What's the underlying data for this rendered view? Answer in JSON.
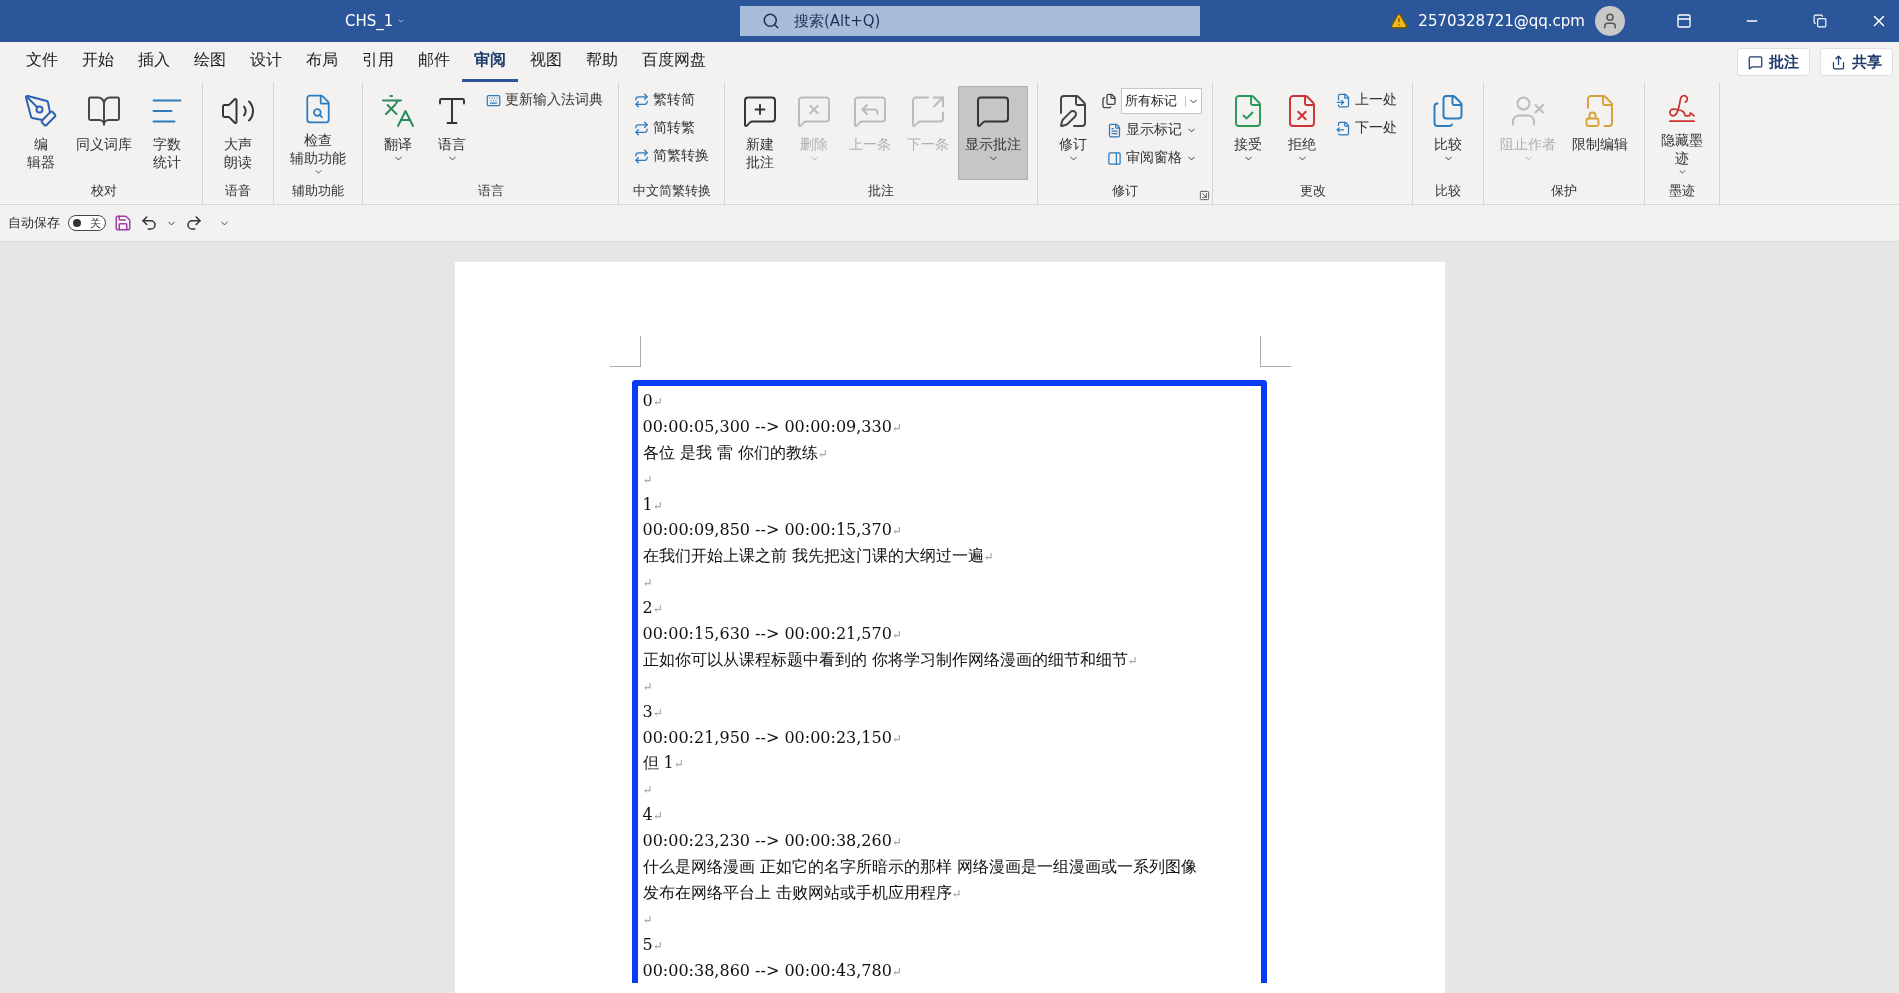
{
  "title_bar": {
    "document_title": "CHS_1",
    "search": {
      "placeholder": "搜索(Alt+Q)"
    },
    "account": "2570328721@qq.cpm"
  },
  "menu_tabs": [
    {
      "label": "文件",
      "selected": false
    },
    {
      "label": "开始",
      "selected": false
    },
    {
      "label": "插入",
      "selected": false
    },
    {
      "label": "绘图",
      "selected": false
    },
    {
      "label": "设计",
      "selected": false
    },
    {
      "label": "布局",
      "selected": false
    },
    {
      "label": "引用",
      "selected": false
    },
    {
      "label": "邮件",
      "selected": false
    },
    {
      "label": "审阅",
      "selected": true
    },
    {
      "label": "视图",
      "selected": false
    },
    {
      "label": "帮助",
      "selected": false
    },
    {
      "label": "百度网盘",
      "selected": false
    }
  ],
  "header_buttons": [
    "批注",
    "共享"
  ],
  "ribbon_groups": [
    {
      "label": "校对",
      "items": [
        {
          "kind": "large",
          "lines": [
            "编",
            "辑器"
          ],
          "disabled": false,
          "selected": false,
          "has_menu": false
        },
        {
          "kind": "large",
          "lines": [
            "同义词库"
          ],
          "disabled": false,
          "selected": false,
          "has_menu": false
        },
        {
          "kind": "large",
          "lines": [
            "字数",
            "统计"
          ],
          "disabled": false,
          "selected": false,
          "has_menu": false
        }
      ]
    },
    {
      "label": "语音",
      "items": [
        {
          "kind": "large",
          "lines": [
            "大声",
            "朗读"
          ],
          "disabled": false,
          "selected": false,
          "has_menu": false
        }
      ]
    },
    {
      "label": "辅助功能",
      "items": [
        {
          "kind": "large",
          "lines": [
            "检查",
            "辅助功能"
          ],
          "disabled": false,
          "selected": false,
          "has_menu": true
        }
      ]
    },
    {
      "label": "语言",
      "items": [
        {
          "kind": "large",
          "lines": [
            "翻译"
          ],
          "disabled": false,
          "selected": false,
          "has_menu": true
        },
        {
          "kind": "large",
          "lines": [
            "语言"
          ],
          "disabled": false,
          "selected": false,
          "has_menu": true
        },
        {
          "kind": "small",
          "label": "更新输入法词典",
          "disabled": false,
          "has_menu": false
        }
      ]
    },
    {
      "label": "中文简繁转换",
      "items": [
        {
          "kind": "small",
          "label": "繁转简",
          "disabled": false,
          "has_menu": false
        },
        {
          "kind": "small",
          "label": "简转繁",
          "disabled": false,
          "has_menu": false
        },
        {
          "kind": "small",
          "label": "简繁转换",
          "disabled": false,
          "has_menu": false
        }
      ]
    },
    {
      "label": "批注",
      "items": [
        {
          "kind": "large",
          "lines": [
            "新建",
            "批注"
          ],
          "disabled": false,
          "selected": false,
          "has_menu": false
        },
        {
          "kind": "large",
          "lines": [
            "删除"
          ],
          "disabled": true,
          "selected": false,
          "has_menu": true
        },
        {
          "kind": "large",
          "lines": [
            "上一条"
          ],
          "disabled": true,
          "selected": false,
          "has_menu": false
        },
        {
          "kind": "large",
          "lines": [
            "下一条"
          ],
          "disabled": true,
          "selected": false,
          "has_menu": false
        },
        {
          "kind": "large",
          "lines": [
            "显示批注"
          ],
          "disabled": false,
          "selected": true,
          "has_menu": true
        }
      ]
    },
    {
      "label": "修订",
      "launcher": true,
      "items": [
        {
          "kind": "large",
          "lines": [
            "修订"
          ],
          "disabled": false,
          "selected": false,
          "has_menu": true
        },
        {
          "kind": "combo",
          "value": "所有标记"
        },
        {
          "kind": "small",
          "label": "显示标记",
          "disabled": false,
          "has_menu": true
        },
        {
          "kind": "small",
          "label": "审阅窗格",
          "disabled": false,
          "has_menu": true
        }
      ]
    },
    {
      "label": "更改",
      "items": [
        {
          "kind": "large",
          "lines": [
            "接受"
          ],
          "disabled": false,
          "selected": false,
          "has_menu": true
        },
        {
          "kind": "large",
          "lines": [
            "拒绝"
          ],
          "disabled": false,
          "selected": false,
          "has_menu": true
        },
        {
          "kind": "small",
          "label": "上一处",
          "disabled": false,
          "has_menu": false
        },
        {
          "kind": "small",
          "label": "下一处",
          "disabled": false,
          "has_menu": false
        }
      ]
    },
    {
      "label": "比较",
      "items": [
        {
          "kind": "large",
          "lines": [
            "比较"
          ],
          "disabled": false,
          "selected": false,
          "has_menu": true
        }
      ]
    },
    {
      "label": "保护",
      "items": [
        {
          "kind": "large",
          "lines": [
            "阻止作者"
          ],
          "disabled": true,
          "selected": false,
          "has_menu": true
        },
        {
          "kind": "large",
          "lines": [
            "限制编辑"
          ],
          "disabled": false,
          "selected": false,
          "has_menu": false
        }
      ]
    },
    {
      "label": "墨迹",
      "items": [
        {
          "kind": "large",
          "lines": [
            "隐藏墨",
            "迹"
          ],
          "disabled": false,
          "selected": false,
          "has_menu": true
        }
      ]
    }
  ],
  "quick_access": {
    "autosave_label": "自动保存",
    "autosave": {
      "on": false,
      "label": "关"
    }
  },
  "document": {
    "lines": [
      {
        "text": "0",
        "return_mark": "↵"
      },
      {
        "text": "00:00:05,300 --> 00:00:09,330",
        "return_mark": "↵"
      },
      {
        "text": "各位  是我  雷  你们的教练",
        "return_mark": "↵"
      },
      {
        "return_mark": "↵"
      },
      {
        "text": "1",
        "return_mark": "↵"
      },
      {
        "text": "00:00:09,850 --> 00:00:15,370",
        "return_mark": "↵"
      },
      {
        "text": "在我们开始上课之前  我先把这门课的大纲过一遍",
        "return_mark": "↵"
      },
      {
        "return_mark": "↵"
      },
      {
        "text": "2",
        "return_mark": "↵"
      },
      {
        "text": "00:00:15,630 --> 00:00:21,570",
        "return_mark": "↵"
      },
      {
        "text": "正如你可以从课程标题中看到的  你将学习制作网络漫画的细节和细节",
        "return_mark": "↵"
      },
      {
        "return_mark": "↵"
      },
      {
        "text": "3",
        "return_mark": "↵"
      },
      {
        "text": "00:00:21,950 --> 00:00:23,150",
        "return_mark": "↵"
      },
      {
        "text": "但 1",
        "return_mark": "↵"
      },
      {
        "return_mark": "↵"
      },
      {
        "text": "4",
        "return_mark": "↵"
      },
      {
        "text": "00:00:23,230 --> 00:00:38,260",
        "return_mark": "↵"
      },
      {
        "text": "什么是网络漫画  正如它的名字所暗示的那样  网络漫画是一组漫画或一系列图像"
      },
      {
        "text": "发布在网络平台上  击败网站或手机应用程序",
        "return_mark": "↵"
      },
      {
        "return_mark": "↵"
      },
      {
        "text": "5",
        "return_mark": "↵"
      },
      {
        "text": "00:00:38,860 --> 00:00:43,780",
        "return_mark": "↵"
      }
    ]
  }
}
